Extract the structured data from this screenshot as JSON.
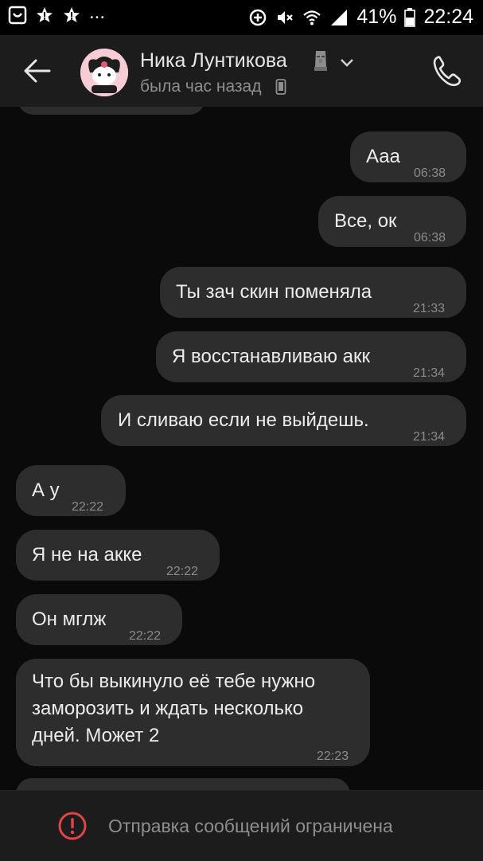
{
  "status_bar": {
    "dots": "...",
    "battery": "41%",
    "time": "22:24",
    "icons": [
      "smile-notification-icon",
      "star-notification-icon",
      "star-notification-icon",
      "data-saver-icon",
      "mute-icon",
      "wifi-icon",
      "signal-icon",
      "battery-icon"
    ]
  },
  "header": {
    "name": "Ника Лунтикова",
    "name_emoji": "moai-icon",
    "status": "была час назад",
    "icons": [
      "back-arrow-icon",
      "avatar",
      "chevron-down-icon",
      "phone-icon",
      "mobile-device-icon"
    ]
  },
  "messages": [
    {
      "dir": "out",
      "text": "Ааа",
      "time": "06:38"
    },
    {
      "dir": "out",
      "text": "Все, ок",
      "time": "06:38"
    },
    {
      "dir": "out",
      "text": "Ты зач скин поменяла",
      "time": "21:33"
    },
    {
      "dir": "out",
      "text": "Я восстанавливаю акк",
      "time": "21:34"
    },
    {
      "dir": "out",
      "text": "И сливаю если не выйдешь.",
      "time": "21:34"
    },
    {
      "dir": "in",
      "text": "А у",
      "time": "22:22"
    },
    {
      "dir": "in",
      "text": "Я не на акке",
      "time": "22:22"
    },
    {
      "dir": "in",
      "text": "Он мглж",
      "time": "22:22"
    },
    {
      "dir": "in",
      "lines": [
        "Что бы выкинуло её тебе нужно",
        "заморозить и ждать несколько",
        "дней. Может 2"
      ],
      "time": "22:23"
    }
  ],
  "footer": {
    "text": "Отправка сообщений ограничена",
    "icon": "warning-circle-icon"
  },
  "colors": {
    "background": "#0a0a0a",
    "header": "#1c1c1c",
    "bubble": "#2d2d2d",
    "text": "#ececec",
    "time": "#8a8a8a",
    "warning": "#e0454a"
  }
}
